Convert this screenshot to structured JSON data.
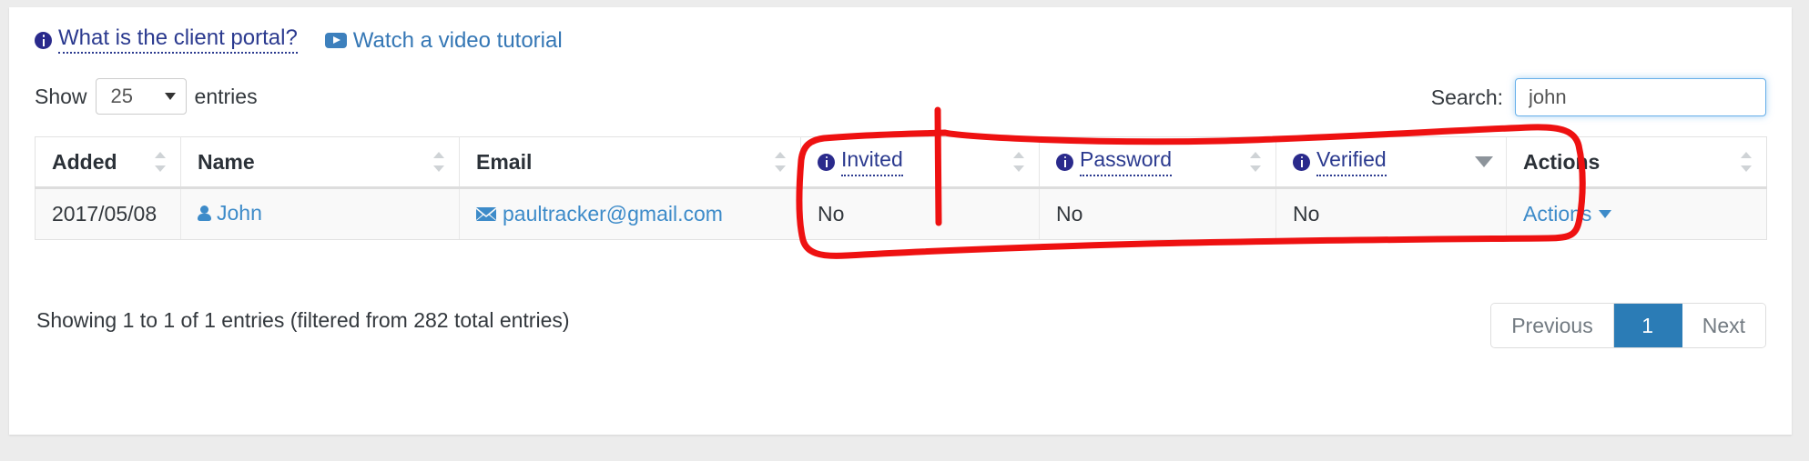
{
  "help_links": [
    {
      "icon": "info-icon",
      "label": "What is the client portal?"
    },
    {
      "icon": "video-play-icon",
      "label": "Watch a video tutorial"
    }
  ],
  "controls": {
    "show_label": "Show",
    "entries_label": "entries",
    "page_length_value": "25",
    "search_label": "Search:",
    "search_value": "john",
    "search_placeholder": ""
  },
  "table": {
    "columns": [
      {
        "label": "Added",
        "sort": "both",
        "has_info_icon": false
      },
      {
        "label": "Name",
        "sort": "both",
        "has_info_icon": false
      },
      {
        "label": "Email",
        "sort": "both",
        "has_info_icon": false
      },
      {
        "label": "Invited",
        "sort": "both",
        "has_info_icon": true
      },
      {
        "label": "Password",
        "sort": "both",
        "has_info_icon": true
      },
      {
        "label": "Verified",
        "sort": "desc",
        "has_info_icon": true
      },
      {
        "label": "Actions",
        "sort": "both",
        "has_info_icon": false
      }
    ],
    "rows": [
      {
        "added": "2017/05/08",
        "name": "John",
        "email": "paultracker@gmail.com",
        "invited": "No",
        "password": "No",
        "verified": "No",
        "actions": "Actions"
      }
    ]
  },
  "footer": {
    "showing_info": "Showing 1 to 1 of 1 entries (filtered from 282 total entries)",
    "pagination": {
      "previous": "Previous",
      "pages": [
        "1"
      ],
      "next": "Next",
      "active_page": "1"
    }
  },
  "colors": {
    "link_blue": "#3d8bc9",
    "header_link_navy": "#2b3a8f",
    "value_red": "#a94442",
    "pager_active": "#2b7cb6",
    "annotation_red": "#ee1111",
    "page_bg": "#ececec"
  },
  "annotation": {
    "shape": "hand-drawn-rectangle",
    "encircles": [
      "Invited",
      "Password",
      "Verified"
    ]
  }
}
